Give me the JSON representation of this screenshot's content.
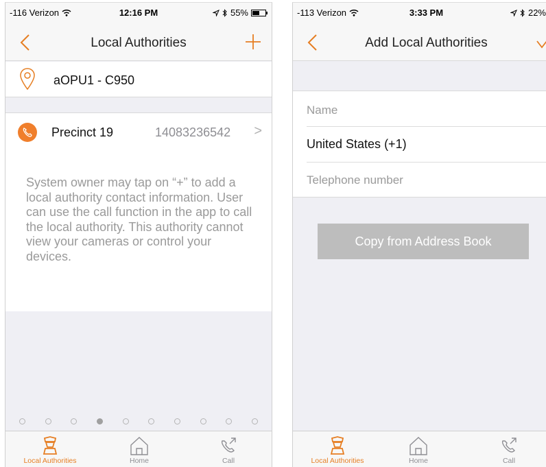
{
  "colors": {
    "accent": "#e67e22",
    "accent_fill": "#f07f2c",
    "button_gray": "#bdbdbd"
  },
  "left": {
    "status": {
      "carrier": "-116 Verizon",
      "time": "12:16 PM",
      "battery": "55%",
      "battery_level": 0.55
    },
    "nav": {
      "title": "Local Authorities",
      "left_icon": "back-chevron",
      "right_icon": "plus"
    },
    "location": {
      "icon": "location-pin",
      "name": "aOPU1 - C950"
    },
    "authority": {
      "icon": "phone",
      "name": "Precinct 19",
      "phone": "14083236542",
      "chevron": ">"
    },
    "info_text": "System owner may tap on “+” to add a local authority contact information. User can use the call function in the app to call the local authority. This authority cannot view your cameras or control your devices.",
    "page_dots": {
      "count": 10,
      "active_index": 3
    },
    "tabs": [
      {
        "label": "Local Authorities",
        "icon": "officer",
        "active": true
      },
      {
        "label": "Home",
        "icon": "home",
        "active": false
      },
      {
        "label": "Call",
        "icon": "phone-call",
        "active": false
      }
    ]
  },
  "right": {
    "status": {
      "carrier": "-113 Verizon",
      "time": "3:33 PM",
      "battery": "22%",
      "battery_level": 0.22
    },
    "nav": {
      "title": "Add Local Authorities",
      "left_icon": "back-chevron",
      "right_icon": "checkmark"
    },
    "form": {
      "name_placeholder": "Name",
      "country": "United States (+1)",
      "country_chevron": ">",
      "phone_placeholder": "Telephone number"
    },
    "copy_button": "Copy from Address Book",
    "tabs": [
      {
        "label": "Local Authorities",
        "icon": "officer",
        "active": true
      },
      {
        "label": "Home",
        "icon": "home",
        "active": false
      },
      {
        "label": "Call",
        "icon": "phone-call",
        "active": false
      }
    ]
  }
}
